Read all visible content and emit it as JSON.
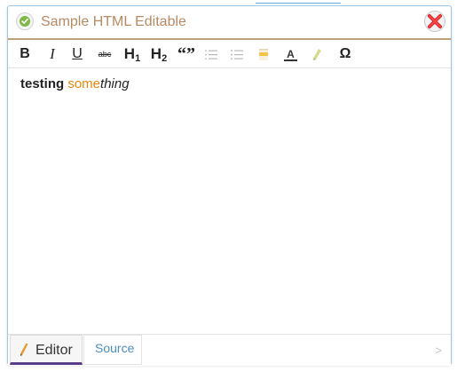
{
  "window": {
    "title": "Sample HTML Editable",
    "status_icon": "check-circle-icon",
    "close_icon": "close-x-icon"
  },
  "toolbar": {
    "bold": "B",
    "italic": "I",
    "underline": "U",
    "strikethrough": "abc",
    "h1_main": "H",
    "h1_sub": "1",
    "h2_main": "H",
    "h2_sub": "2",
    "quote": "“”",
    "ordered_list_icon": "ordered-list-icon",
    "unordered_list_icon": "unordered-list-icon",
    "highlight_icon": "highlight-icon",
    "font_color_icon": "font-color-icon",
    "pen_icon": "pen-icon",
    "special_char": "Ω"
  },
  "editor": {
    "word1": "testing",
    "space": " ",
    "word2_colored": "some",
    "word2_italic": "thing"
  },
  "tabs": [
    {
      "label": "Editor",
      "icon": "pencil-icon",
      "active": true
    },
    {
      "label": "Source",
      "active": false
    }
  ],
  "footer": {
    "next_arrow": ">"
  },
  "colors": {
    "title": "#b68a62",
    "accent_orange": "#e8870c",
    "tab_source": "#4a8ec0",
    "active_tab_underline": "#5a3e8a",
    "border": "#9ec6e6"
  }
}
